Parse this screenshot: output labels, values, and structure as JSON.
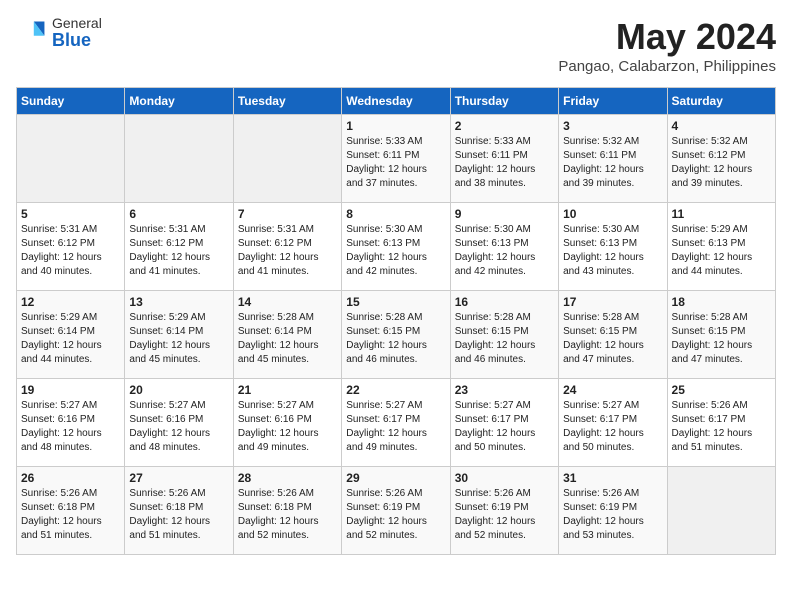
{
  "logo": {
    "general": "General",
    "blue": "Blue"
  },
  "title": {
    "month_year": "May 2024",
    "location": "Pangao, Calabarzon, Philippines"
  },
  "days_of_week": [
    "Sunday",
    "Monday",
    "Tuesday",
    "Wednesday",
    "Thursday",
    "Friday",
    "Saturday"
  ],
  "weeks": [
    [
      {
        "day": "",
        "sunrise": "",
        "sunset": "",
        "daylight": ""
      },
      {
        "day": "",
        "sunrise": "",
        "sunset": "",
        "daylight": ""
      },
      {
        "day": "",
        "sunrise": "",
        "sunset": "",
        "daylight": ""
      },
      {
        "day": "1",
        "sunrise": "Sunrise: 5:33 AM",
        "sunset": "Sunset: 6:11 PM",
        "daylight": "Daylight: 12 hours and 37 minutes."
      },
      {
        "day": "2",
        "sunrise": "Sunrise: 5:33 AM",
        "sunset": "Sunset: 6:11 PM",
        "daylight": "Daylight: 12 hours and 38 minutes."
      },
      {
        "day": "3",
        "sunrise": "Sunrise: 5:32 AM",
        "sunset": "Sunset: 6:11 PM",
        "daylight": "Daylight: 12 hours and 39 minutes."
      },
      {
        "day": "4",
        "sunrise": "Sunrise: 5:32 AM",
        "sunset": "Sunset: 6:12 PM",
        "daylight": "Daylight: 12 hours and 39 minutes."
      }
    ],
    [
      {
        "day": "5",
        "sunrise": "Sunrise: 5:31 AM",
        "sunset": "Sunset: 6:12 PM",
        "daylight": "Daylight: 12 hours and 40 minutes."
      },
      {
        "day": "6",
        "sunrise": "Sunrise: 5:31 AM",
        "sunset": "Sunset: 6:12 PM",
        "daylight": "Daylight: 12 hours and 41 minutes."
      },
      {
        "day": "7",
        "sunrise": "Sunrise: 5:31 AM",
        "sunset": "Sunset: 6:12 PM",
        "daylight": "Daylight: 12 hours and 41 minutes."
      },
      {
        "day": "8",
        "sunrise": "Sunrise: 5:30 AM",
        "sunset": "Sunset: 6:13 PM",
        "daylight": "Daylight: 12 hours and 42 minutes."
      },
      {
        "day": "9",
        "sunrise": "Sunrise: 5:30 AM",
        "sunset": "Sunset: 6:13 PM",
        "daylight": "Daylight: 12 hours and 42 minutes."
      },
      {
        "day": "10",
        "sunrise": "Sunrise: 5:30 AM",
        "sunset": "Sunset: 6:13 PM",
        "daylight": "Daylight: 12 hours and 43 minutes."
      },
      {
        "day": "11",
        "sunrise": "Sunrise: 5:29 AM",
        "sunset": "Sunset: 6:13 PM",
        "daylight": "Daylight: 12 hours and 44 minutes."
      }
    ],
    [
      {
        "day": "12",
        "sunrise": "Sunrise: 5:29 AM",
        "sunset": "Sunset: 6:14 PM",
        "daylight": "Daylight: 12 hours and 44 minutes."
      },
      {
        "day": "13",
        "sunrise": "Sunrise: 5:29 AM",
        "sunset": "Sunset: 6:14 PM",
        "daylight": "Daylight: 12 hours and 45 minutes."
      },
      {
        "day": "14",
        "sunrise": "Sunrise: 5:28 AM",
        "sunset": "Sunset: 6:14 PM",
        "daylight": "Daylight: 12 hours and 45 minutes."
      },
      {
        "day": "15",
        "sunrise": "Sunrise: 5:28 AM",
        "sunset": "Sunset: 6:15 PM",
        "daylight": "Daylight: 12 hours and 46 minutes."
      },
      {
        "day": "16",
        "sunrise": "Sunrise: 5:28 AM",
        "sunset": "Sunset: 6:15 PM",
        "daylight": "Daylight: 12 hours and 46 minutes."
      },
      {
        "day": "17",
        "sunrise": "Sunrise: 5:28 AM",
        "sunset": "Sunset: 6:15 PM",
        "daylight": "Daylight: 12 hours and 47 minutes."
      },
      {
        "day": "18",
        "sunrise": "Sunrise: 5:28 AM",
        "sunset": "Sunset: 6:15 PM",
        "daylight": "Daylight: 12 hours and 47 minutes."
      }
    ],
    [
      {
        "day": "19",
        "sunrise": "Sunrise: 5:27 AM",
        "sunset": "Sunset: 6:16 PM",
        "daylight": "Daylight: 12 hours and 48 minutes."
      },
      {
        "day": "20",
        "sunrise": "Sunrise: 5:27 AM",
        "sunset": "Sunset: 6:16 PM",
        "daylight": "Daylight: 12 hours and 48 minutes."
      },
      {
        "day": "21",
        "sunrise": "Sunrise: 5:27 AM",
        "sunset": "Sunset: 6:16 PM",
        "daylight": "Daylight: 12 hours and 49 minutes."
      },
      {
        "day": "22",
        "sunrise": "Sunrise: 5:27 AM",
        "sunset": "Sunset: 6:17 PM",
        "daylight": "Daylight: 12 hours and 49 minutes."
      },
      {
        "day": "23",
        "sunrise": "Sunrise: 5:27 AM",
        "sunset": "Sunset: 6:17 PM",
        "daylight": "Daylight: 12 hours and 50 minutes."
      },
      {
        "day": "24",
        "sunrise": "Sunrise: 5:27 AM",
        "sunset": "Sunset: 6:17 PM",
        "daylight": "Daylight: 12 hours and 50 minutes."
      },
      {
        "day": "25",
        "sunrise": "Sunrise: 5:26 AM",
        "sunset": "Sunset: 6:17 PM",
        "daylight": "Daylight: 12 hours and 51 minutes."
      }
    ],
    [
      {
        "day": "26",
        "sunrise": "Sunrise: 5:26 AM",
        "sunset": "Sunset: 6:18 PM",
        "daylight": "Daylight: 12 hours and 51 minutes."
      },
      {
        "day": "27",
        "sunrise": "Sunrise: 5:26 AM",
        "sunset": "Sunset: 6:18 PM",
        "daylight": "Daylight: 12 hours and 51 minutes."
      },
      {
        "day": "28",
        "sunrise": "Sunrise: 5:26 AM",
        "sunset": "Sunset: 6:18 PM",
        "daylight": "Daylight: 12 hours and 52 minutes."
      },
      {
        "day": "29",
        "sunrise": "Sunrise: 5:26 AM",
        "sunset": "Sunset: 6:19 PM",
        "daylight": "Daylight: 12 hours and 52 minutes."
      },
      {
        "day": "30",
        "sunrise": "Sunrise: 5:26 AM",
        "sunset": "Sunset: 6:19 PM",
        "daylight": "Daylight: 12 hours and 52 minutes."
      },
      {
        "day": "31",
        "sunrise": "Sunrise: 5:26 AM",
        "sunset": "Sunset: 6:19 PM",
        "daylight": "Daylight: 12 hours and 53 minutes."
      },
      {
        "day": "",
        "sunrise": "",
        "sunset": "",
        "daylight": ""
      }
    ]
  ]
}
